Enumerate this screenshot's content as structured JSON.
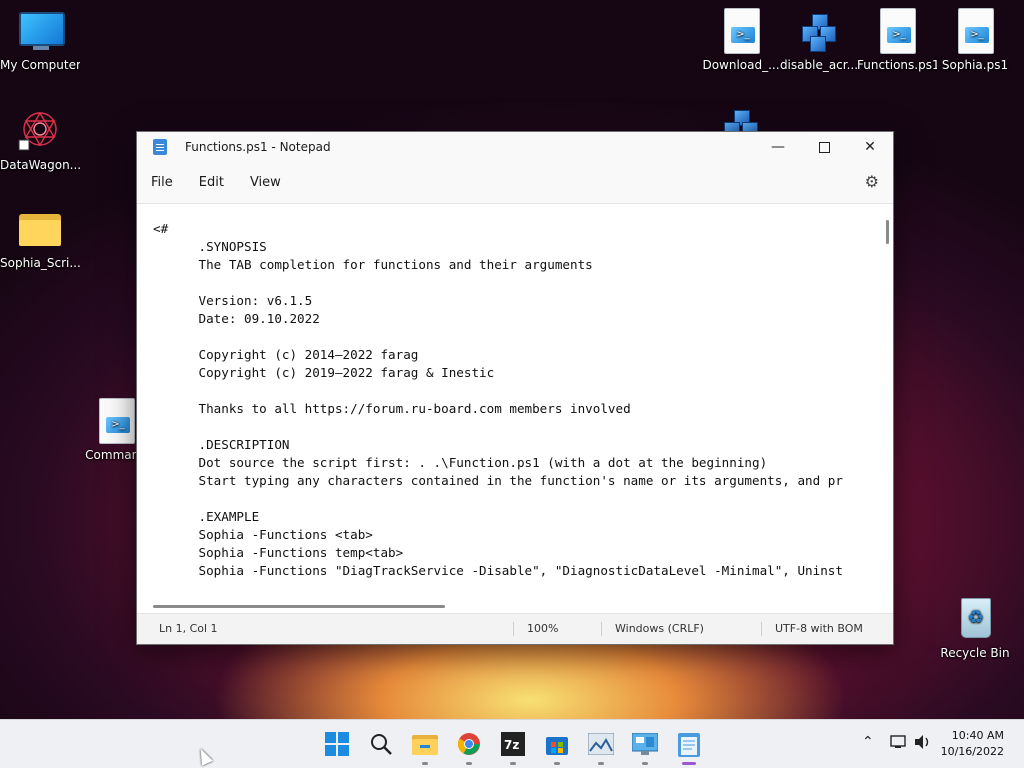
{
  "desktop": {
    "icons": [
      {
        "label": "My Computer",
        "icon": "monitor-icon"
      },
      {
        "label": "DataWagon...",
        "icon": "datawagon-icon"
      },
      {
        "label": "Sophia_Scri...",
        "icon": "folder-icon"
      },
      {
        "label": "Command",
        "icon": "powershell-script-icon"
      },
      {
        "label": "Download_...",
        "icon": "powershell-script-icon"
      },
      {
        "label": "disable_acr...",
        "icon": "cubes-icon"
      },
      {
        "label": "Functions.ps1",
        "icon": "powershell-script-icon"
      },
      {
        "label": "Sophia.ps1",
        "icon": "powershell-script-icon"
      },
      {
        "label": "Recycle Bin",
        "icon": "recycle-bin-icon"
      }
    ]
  },
  "notepad": {
    "title": "Functions.ps1 - Notepad",
    "menu": [
      "File",
      "Edit",
      "View"
    ],
    "content": "<#\n      .SYNOPSIS\n      The TAB completion for functions and their arguments\n\n      Version: v6.1.5\n      Date: 09.10.2022\n\n      Copyright (c) 2014—2022 farag\n      Copyright (c) 2019—2022 farag & Inestic\n\n      Thanks to all https://forum.ru-board.com members involved\n\n      .DESCRIPTION\n      Dot source the script first: . .\\Function.ps1 (with a dot at the beginning)\n      Start typing any characters contained in the function's name or its arguments, and pr\n\n      .EXAMPLE\n      Sophia -Functions <tab>\n      Sophia -Functions temp<tab>\n      Sophia -Functions \"DiagTrackService -Disable\", \"DiagnosticDataLevel -Minimal\", Uninst",
    "status": {
      "position": "Ln 1, Col 1",
      "zoom": "100%",
      "line_ending": "Windows (CRLF)",
      "encoding": "UTF-8 with BOM"
    }
  },
  "taskbar": {
    "apps": [
      "start-icon",
      "search-icon",
      "file-explorer-icon",
      "chrome-icon",
      "7zip-icon",
      "store-icon",
      "photos-icon",
      "control-panel-icon",
      "notepad-icon"
    ],
    "clock": {
      "time": "10:40 AM",
      "date": "10/16/2022"
    }
  }
}
